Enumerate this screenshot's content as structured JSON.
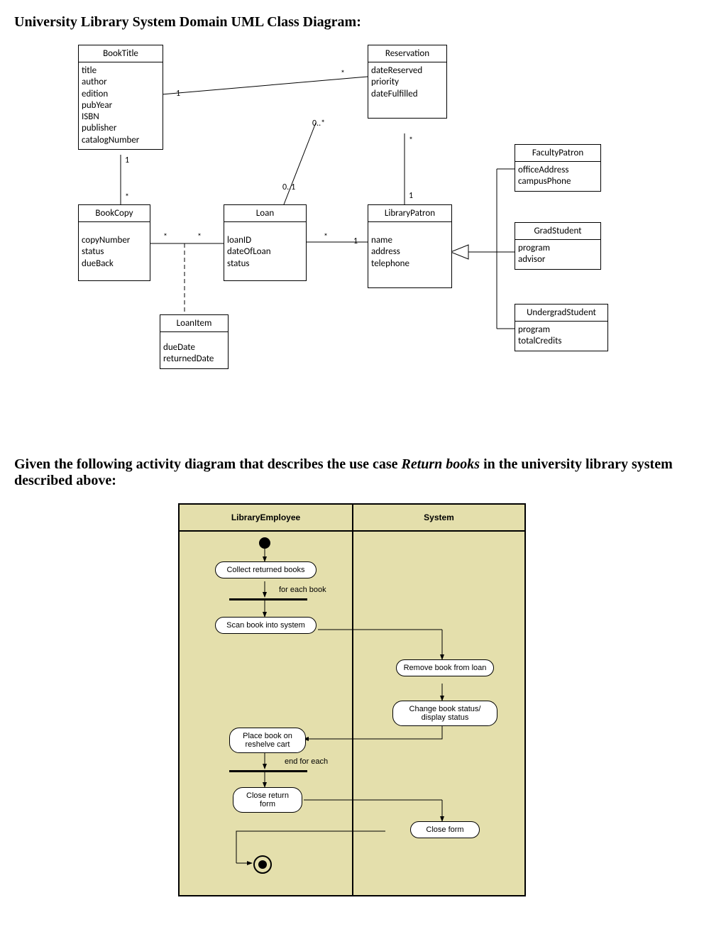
{
  "heading1_prefix": "University Library System Domain UML Class Diagram:",
  "heading2_prefix": "Given the following activity diagram that describes the use case ",
  "heading2_italic": "Return books",
  "heading2_suffix": " in the university library system described above:",
  "classes": {
    "BookTitle": {
      "name": "BookTitle",
      "attrs": [
        "title",
        "author",
        "edition",
        "pubYear",
        "ISBN",
        "publisher",
        "catalogNumber"
      ]
    },
    "Reservation": {
      "name": "Reservation",
      "attrs": [
        "dateReserved",
        "priority",
        "dateFulfilled"
      ]
    },
    "BookCopy": {
      "name": "BookCopy",
      "attrs": [
        "copyNumber",
        "status",
        "dueBack"
      ]
    },
    "Loan": {
      "name": "Loan",
      "attrs": [
        "loanID",
        "dateOfLoan",
        "status"
      ]
    },
    "LibraryPatron": {
      "name": "LibraryPatron",
      "attrs": [
        "name",
        "address",
        "telephone"
      ]
    },
    "LoanItem": {
      "name": "LoanItem",
      "attrs": [
        "dueDate",
        "returnedDate"
      ]
    },
    "FacultyPatron": {
      "name": "FacultyPatron",
      "attrs": [
        "officeAddress",
        "campusPhone"
      ]
    },
    "GradStudent": {
      "name": "GradStudent",
      "attrs": [
        "program",
        "advisor"
      ]
    },
    "UndergradStudent": {
      "name": "UndergradStudent",
      "attrs": [
        "program",
        "totalCredits"
      ]
    }
  },
  "multiplicities": {
    "bt_res_bt": "1",
    "bt_res_res": "*",
    "bt_bc_bt": "1",
    "bt_bc_bc": "*",
    "bc_loan_bc": "*",
    "bc_loan_loan": "*",
    "loan_res_loan": "0..1",
    "loan_res_res": "0..*",
    "loan_patron_loan": "*",
    "loan_patron_patron": "1",
    "res_patron_res": "*",
    "res_patron_patron": "1"
  },
  "chart_data": {
    "type": "uml_class_diagram",
    "classes": [
      {
        "name": "BookTitle",
        "attributes": [
          "title",
          "author",
          "edition",
          "pubYear",
          "ISBN",
          "publisher",
          "catalogNumber"
        ]
      },
      {
        "name": "Reservation",
        "attributes": [
          "dateReserved",
          "priority",
          "dateFulfilled"
        ]
      },
      {
        "name": "BookCopy",
        "attributes": [
          "copyNumber",
          "status",
          "dueBack"
        ]
      },
      {
        "name": "Loan",
        "attributes": [
          "loanID",
          "dateOfLoan",
          "status"
        ]
      },
      {
        "name": "LibraryPatron",
        "attributes": [
          "name",
          "address",
          "telephone"
        ]
      },
      {
        "name": "LoanItem",
        "attributes": [
          "dueDate",
          "returnedDate"
        ]
      },
      {
        "name": "FacultyPatron",
        "attributes": [
          "officeAddress",
          "campusPhone"
        ]
      },
      {
        "name": "GradStudent",
        "attributes": [
          "program",
          "advisor"
        ]
      },
      {
        "name": "UndergradStudent",
        "attributes": [
          "program",
          "totalCredits"
        ]
      }
    ],
    "relationships": [
      {
        "from": "BookTitle",
        "to": "Reservation",
        "type": "association",
        "from_mult": "1",
        "to_mult": "*"
      },
      {
        "from": "BookTitle",
        "to": "BookCopy",
        "type": "association",
        "from_mult": "1",
        "to_mult": "*"
      },
      {
        "from": "BookCopy",
        "to": "Loan",
        "type": "association_class",
        "via": "LoanItem",
        "from_mult": "*",
        "to_mult": "*"
      },
      {
        "from": "Loan",
        "to": "Reservation",
        "type": "association",
        "from_mult": "0..1",
        "to_mult": "0..*"
      },
      {
        "from": "Loan",
        "to": "LibraryPatron",
        "type": "association",
        "from_mult": "*",
        "to_mult": "1"
      },
      {
        "from": "Reservation",
        "to": "LibraryPatron",
        "type": "association",
        "from_mult": "*",
        "to_mult": "1"
      },
      {
        "from": "FacultyPatron",
        "to": "LibraryPatron",
        "type": "generalization"
      },
      {
        "from": "GradStudent",
        "to": "LibraryPatron",
        "type": "generalization"
      },
      {
        "from": "UndergradStudent",
        "to": "LibraryPatron",
        "type": "generalization"
      }
    ]
  },
  "activity": {
    "lane_left": "LibraryEmployee",
    "lane_right": "System",
    "nodes": {
      "collect": "Collect returned books",
      "scan": "Scan book into system",
      "remove": "Remove book from loan",
      "change": "Change book status/ display status",
      "place": "Place book on reshelve cart",
      "close_return": "Close return form",
      "close_form": "Close form"
    },
    "labels": {
      "for_each": "for each book",
      "end_for_each": "end for each"
    }
  }
}
